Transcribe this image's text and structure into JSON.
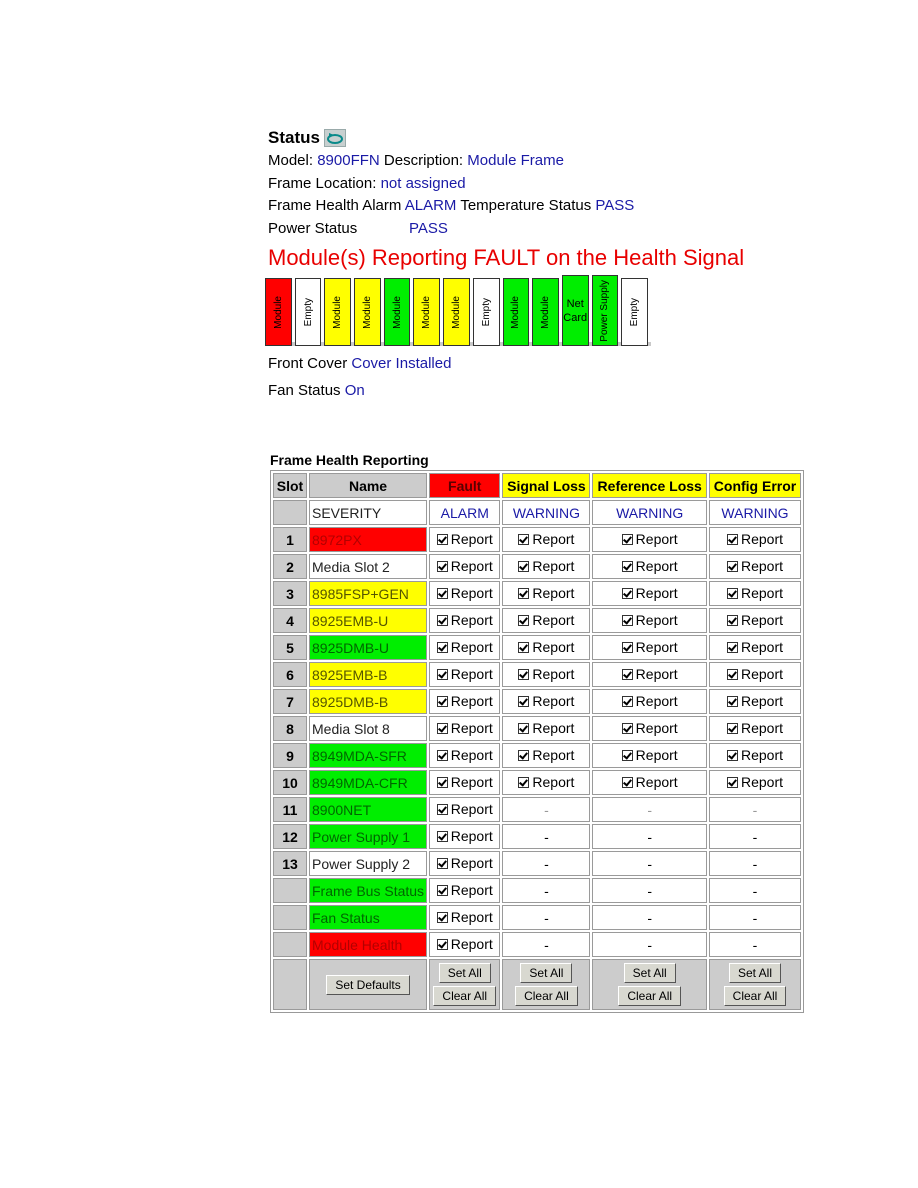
{
  "status": {
    "title": "Status",
    "refresh_icon": "refresh-icon",
    "model_label": "Model:",
    "model_value": "8900FFN",
    "description_label": "Description:",
    "description_value": "Module Frame",
    "location_label": "Frame Location:",
    "location_value": "not assigned",
    "health_alarm_label": "Frame Health Alarm",
    "health_alarm_value": "ALARM",
    "temperature_label": "Temperature Status",
    "temperature_value": "PASS",
    "power_label": "Power Status",
    "power_value": "PASS",
    "fault_banner": "Module(s) Reporting FAULT on the Health Signal",
    "front_cover_label": "Front Cover",
    "front_cover_value": "Cover Installed",
    "fan_label": "Fan Status",
    "fan_value": "On"
  },
  "slots": [
    {
      "label": "Module",
      "color": "red"
    },
    {
      "label": "Empty",
      "color": "white"
    },
    {
      "label": "Module",
      "color": "yellow"
    },
    {
      "label": "Module",
      "color": "yellow"
    },
    {
      "label": "Module",
      "color": "green"
    },
    {
      "label": "Module",
      "color": "yellow"
    },
    {
      "label": "Module",
      "color": "yellow"
    },
    {
      "label": "Empty",
      "color": "white"
    },
    {
      "label": "Module",
      "color": "green"
    },
    {
      "label": "Module",
      "color": "green"
    },
    {
      "label": "Net Card",
      "color": "green"
    },
    {
      "label": "Power Supply",
      "color": "green"
    },
    {
      "label": "Empty",
      "color": "white"
    }
  ],
  "fhr": {
    "title": "Frame Health Reporting",
    "headers": [
      "Slot",
      "Name",
      "Fault",
      "Signal Loss",
      "Reference Loss",
      "Config Error"
    ],
    "severity_label": "SEVERITY",
    "severities": [
      "ALARM",
      "WARNING",
      "WARNING",
      "WARNING"
    ],
    "report_label": "Report",
    "dash": "-",
    "rows": [
      {
        "slot": "1",
        "name": "8972PX",
        "color": "red",
        "reports": [
          true,
          true,
          true,
          true
        ]
      },
      {
        "slot": "2",
        "name": "Media Slot 2",
        "color": "white",
        "reports": [
          true,
          true,
          true,
          true
        ]
      },
      {
        "slot": "3",
        "name": "8985FSP+GEN",
        "color": "yellow",
        "reports": [
          true,
          true,
          true,
          true
        ]
      },
      {
        "slot": "4",
        "name": "8925EMB-U",
        "color": "yellow",
        "reports": [
          true,
          true,
          true,
          true
        ]
      },
      {
        "slot": "5",
        "name": "8925DMB-U",
        "color": "green",
        "reports": [
          true,
          true,
          true,
          true
        ]
      },
      {
        "slot": "6",
        "name": "8925EMB-B",
        "color": "yellow",
        "reports": [
          true,
          true,
          true,
          true
        ]
      },
      {
        "slot": "7",
        "name": "8925DMB-B",
        "color": "yellow",
        "reports": [
          true,
          true,
          true,
          true
        ]
      },
      {
        "slot": "8",
        "name": "Media Slot 8",
        "color": "white",
        "reports": [
          true,
          true,
          true,
          true
        ]
      },
      {
        "slot": "9",
        "name": "8949MDA-SFR",
        "color": "green",
        "reports": [
          true,
          true,
          true,
          true
        ]
      },
      {
        "slot": "10",
        "name": "8949MDA-CFR",
        "color": "green",
        "reports": [
          true,
          true,
          true,
          true
        ]
      },
      {
        "slot": "11",
        "name": "8900NET",
        "color": "green",
        "reports": [
          true,
          null,
          null,
          null
        ],
        "faint_dash": true
      },
      {
        "slot": "12",
        "name": "Power Supply 1",
        "color": "green",
        "reports": [
          true,
          null,
          null,
          null
        ]
      },
      {
        "slot": "13",
        "name": "Power Supply 2",
        "color": "white",
        "reports": [
          true,
          null,
          null,
          null
        ]
      },
      {
        "slot": "",
        "name": "Frame Bus Status",
        "color": "green",
        "reports": [
          true,
          null,
          null,
          null
        ]
      },
      {
        "slot": "",
        "name": "Fan Status",
        "color": "green",
        "reports": [
          true,
          null,
          null,
          null
        ]
      },
      {
        "slot": "",
        "name": "Module Health",
        "color": "red",
        "reports": [
          true,
          null,
          null,
          null
        ]
      }
    ],
    "buttons": {
      "set_defaults": "Set Defaults",
      "set_all": "Set All",
      "clear_all": "Clear All"
    }
  }
}
